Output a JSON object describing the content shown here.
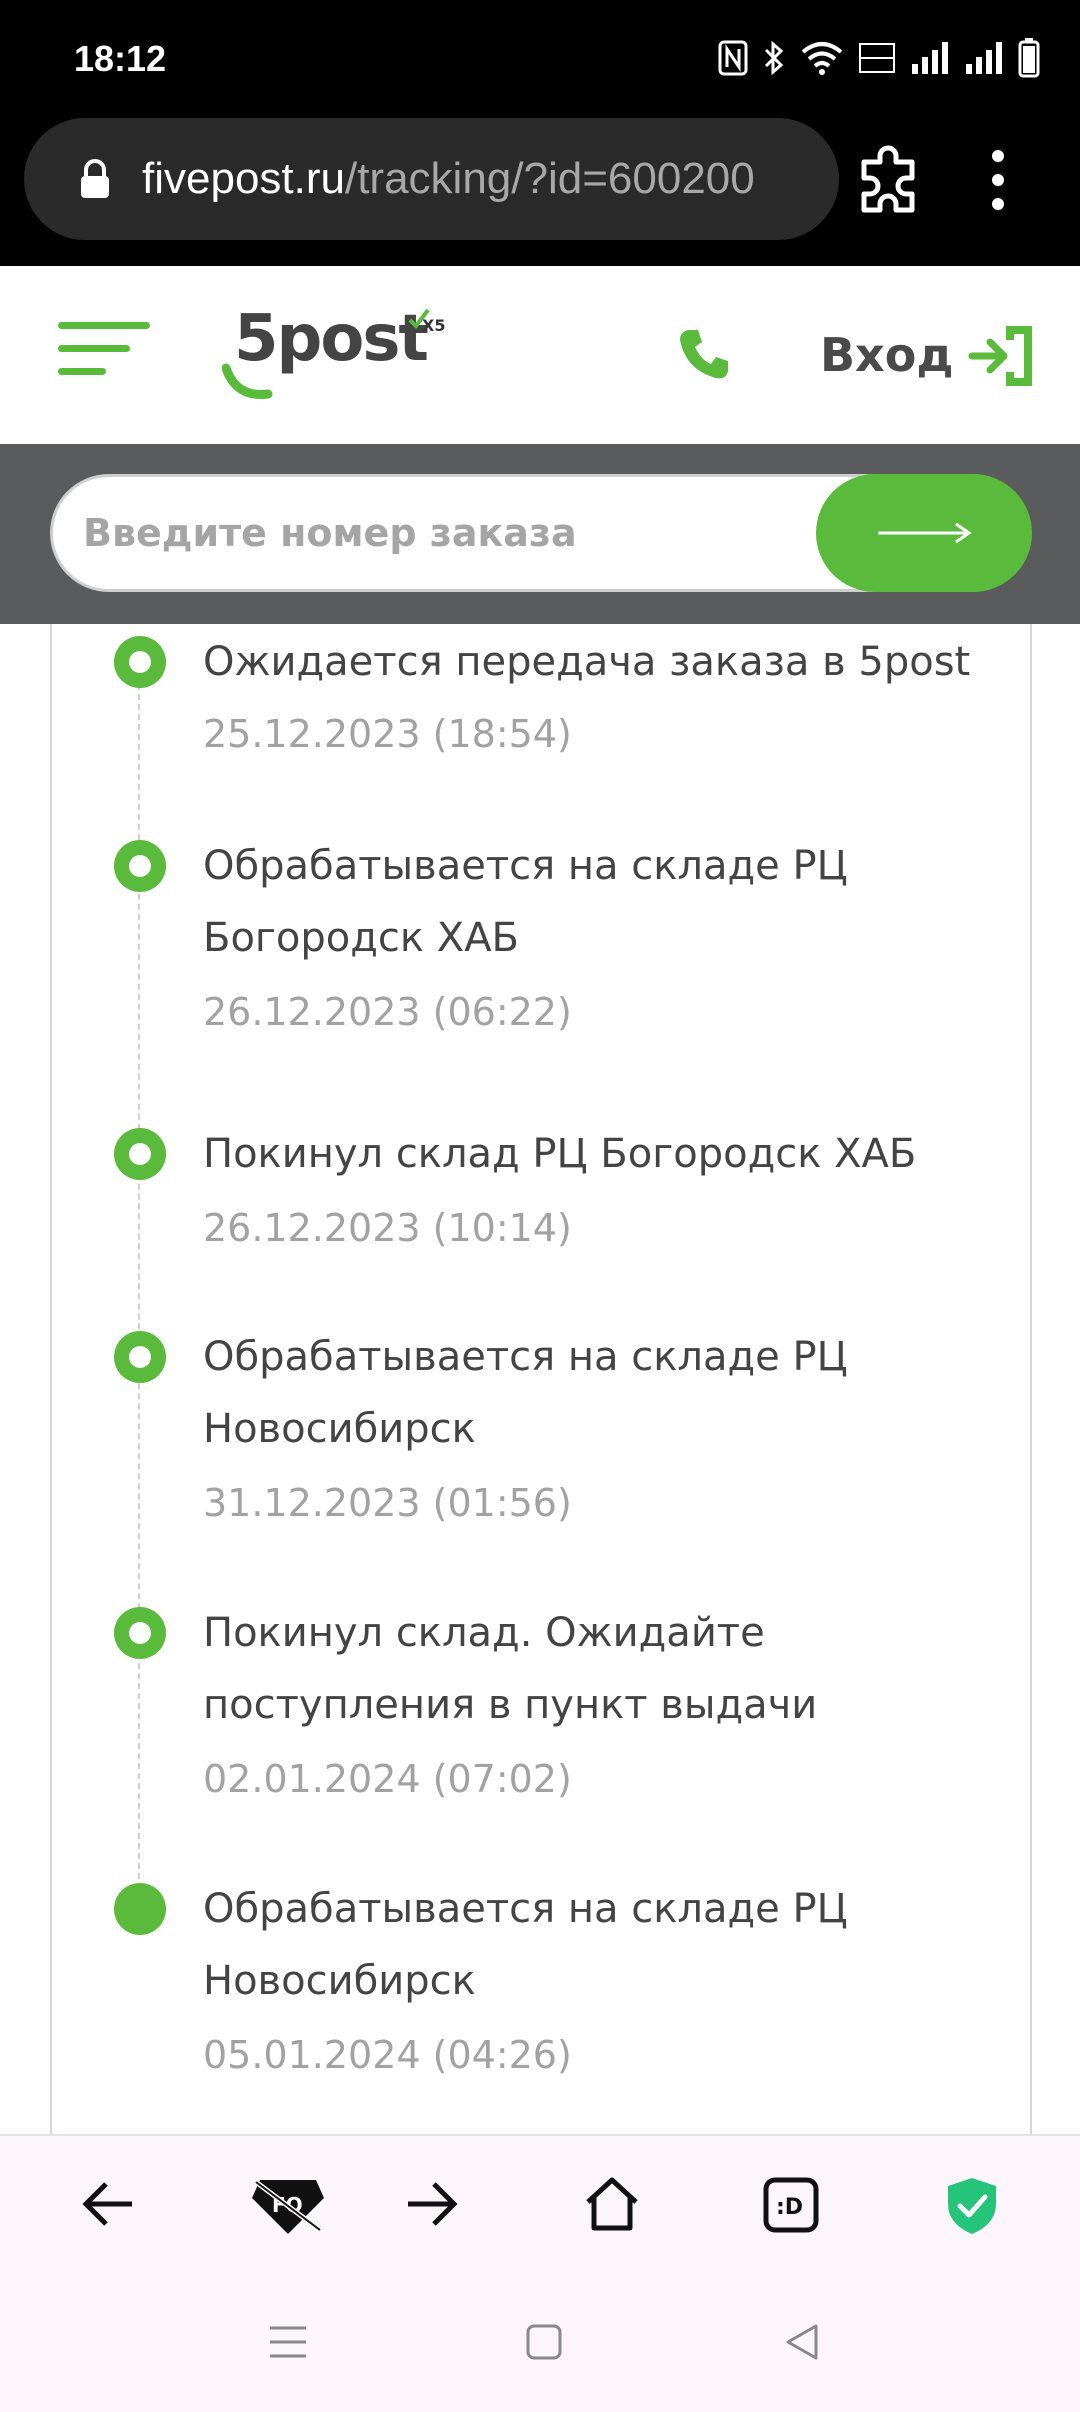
{
  "status_bar": {
    "time": "18:12",
    "icons": [
      "nfc-icon",
      "bluetooth-icon",
      "wifi-icon",
      "volte-icon",
      "signal-icon",
      "signal-icon",
      "battery-icon"
    ]
  },
  "browser": {
    "url_host": "fivepost.ru",
    "url_path": "/tracking/?id=600200"
  },
  "header": {
    "logo_text": "5post",
    "logo_badge": "X5",
    "login_label": "Вход"
  },
  "search": {
    "placeholder": "Введите номер заказа"
  },
  "timeline": {
    "events": [
      {
        "title": "Ожидается передача заказа в 5post",
        "date": "25.12.2023 (18:54)",
        "current": false
      },
      {
        "title": "Обрабатывается на складе РЦ Богородск ХАБ",
        "date": "26.12.2023 (06:22)",
        "current": false
      },
      {
        "title": "Покинул склад РЦ Богородск ХАБ",
        "date": "26.12.2023 (10:14)",
        "current": false
      },
      {
        "title": "Обрабатывается на складе РЦ Новосибирск",
        "date": "31.12.2023 (01:56)",
        "current": false
      },
      {
        "title": "Покинул склад. Ожидайте поступления в пункт выдачи",
        "date": "02.01.2024 (07:02)",
        "current": false
      },
      {
        "title": "Обрабатывается на складе РЦ Новосибирск",
        "date": "05.01.2024 (04:26)",
        "current": true
      }
    ]
  },
  "colors": {
    "accent": "#5aba3b",
    "header_dark": "#5a5b5c",
    "text": "#444444",
    "muted": "#a2a2a2"
  }
}
